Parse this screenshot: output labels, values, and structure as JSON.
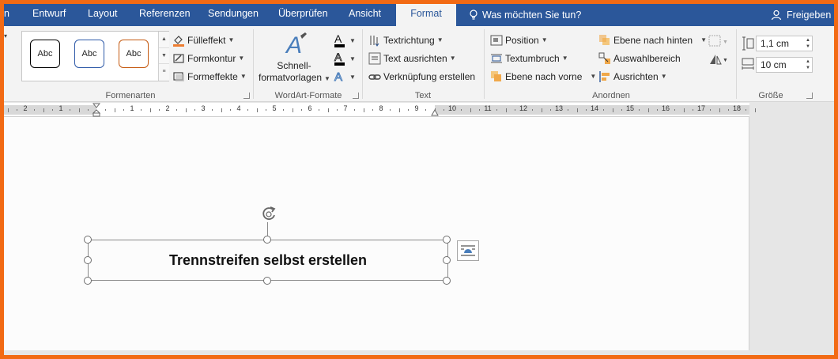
{
  "tabs": {
    "start_partial": "n",
    "entwurf": "Entwurf",
    "layout": "Layout",
    "referenzen": "Referenzen",
    "sendungen": "Sendungen",
    "ueberpruefen": "Überprüfen",
    "ansicht": "Ansicht",
    "format": "Format",
    "active": "Format"
  },
  "tell_me": "Was möchten Sie tun?",
  "share": "Freigeben",
  "ribbon": {
    "formenarten": {
      "label": "Formenarten",
      "swatches": [
        "Abc",
        "Abc",
        "Abc"
      ],
      "swatch_colors": [
        "#000000",
        "#2e5aa8",
        "#c55a11"
      ],
      "fill": "Fülleffekt",
      "outline": "Formkontur",
      "effects": "Formeffekte"
    },
    "wordart": {
      "label": "WordArt-Formate",
      "quick_line1": "Schnell-",
      "quick_line2": "formatvorlagen"
    },
    "text": {
      "label": "Text",
      "direction": "Textrichtung",
      "align": "Text ausrichten",
      "link": "Verknüpfung erstellen"
    },
    "anordnen": {
      "label": "Anordnen",
      "position": "Position",
      "wrap": "Textumbruch",
      "forward": "Ebene nach vorne",
      "backward": "Ebene nach hinten",
      "selection": "Auswahlbereich",
      "align": "Ausrichten"
    },
    "groesse": {
      "label": "Größe",
      "height": "1,1 cm",
      "width": "10 cm"
    }
  },
  "ruler": {
    "left_numbers": [
      "2",
      "1",
      "1",
      "2",
      "3",
      "4",
      "5",
      "6",
      "7",
      "8",
      "9"
    ],
    "right_numbers": [
      "10",
      "11",
      "12",
      "13",
      "14",
      "15",
      "16",
      "17",
      "18"
    ]
  },
  "document": {
    "textbox_text": "Trennstreifen selbst erstellen"
  },
  "colors": {
    "accent": "#2b579a",
    "frame": "#f26a14",
    "ribbon_bg": "#f3f3f3"
  }
}
